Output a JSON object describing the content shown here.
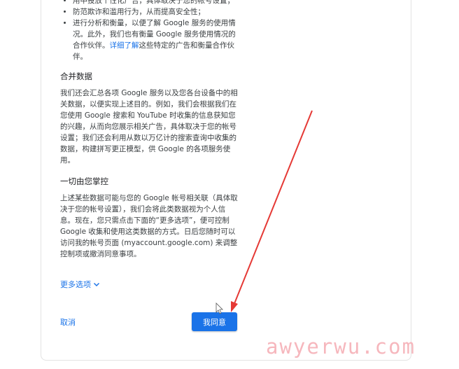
{
  "bullets": [
    "用中投放个性化广告，具体取决于您的帐号设置；",
    "防范欺诈和滥用行为，从而提高安全性；"
  ],
  "bullet3": {
    "text_before": "进行分析和衡量，以便了解 Google 服务的使用情况。此外，我们也有衡量 Google 服务使用情况的合作伙伴。",
    "link": "详细了解",
    "text_after": "这些特定的广告和衡量合作伙伴。"
  },
  "merge": {
    "heading": "合并数据",
    "body": "我们还会汇总各项 Google 服务以及您各台设备中的相关数据，以便实现上述目的。例如，我们会根据我们在您使用 Google 搜索和 YouTube 时收集的信息获知您的兴趣，从而向您展示相关广告，具体取决于您的帐号设置；我们还会利用从数以万亿计的搜索查询中收集的数据，构建拼写更正模型，供 Google 的各项服务使用。"
  },
  "control": {
    "heading": "一切由您掌控",
    "body": "上述某些数据可能与您的 Google 帐号相关联（具体取决于您的帐号设置），我们会将此类数据视为个人信息。现在，您只需点击下面的“更多选项”，便可控制 Google 收集和使用这类数据的方式。日后您随时可以访问我的帐号页面 (myaccount.google.com) 来调整控制项或撤消同意事项。"
  },
  "more_options": "更多选项",
  "cancel_label": "取消",
  "agree_label": "我同意",
  "watermark": "awyerwu.com",
  "colors": {
    "accent": "#1a73e8",
    "arrow": "#e53935",
    "watermark": "#f6b7bd"
  }
}
